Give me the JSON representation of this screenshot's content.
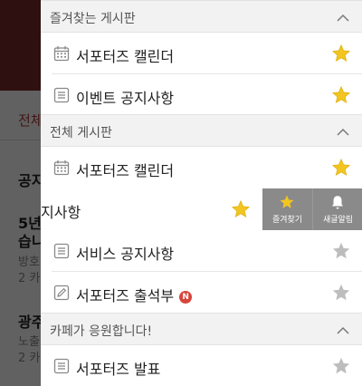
{
  "background": {
    "tab": "전체",
    "items": [
      "공지",
      "5년",
      "습니",
      "방호",
      "2 카",
      "광주",
      "노출",
      "2 카"
    ]
  },
  "sections": [
    {
      "title": "즐겨찾는 게시판",
      "rows": [
        {
          "label": "서포터즈 캘린더",
          "icon": "calendar-icon",
          "starred": true
        },
        {
          "label": "이벤트 공지사항",
          "icon": "list-icon",
          "starred": true
        }
      ]
    },
    {
      "title": "전체 게시판",
      "rows": [
        {
          "label": "서포터즈 캘린더",
          "icon": "calendar-icon",
          "starred": true
        },
        {
          "label": "지사항",
          "icon": "list-icon",
          "starred": true
        },
        {
          "label": "서비스 공지사항",
          "icon": "list-icon",
          "starred": false
        },
        {
          "label": "서포터즈 출석부",
          "icon": "pencil-icon",
          "starred": false,
          "badge": "N"
        }
      ]
    },
    {
      "title": "카페가 응원합니다!",
      "rows": [
        {
          "label": "서포터즈 발표",
          "icon": "list-icon",
          "starred": false
        }
      ]
    }
  ],
  "swipe_actions": {
    "favorite": "즐겨찾기",
    "notify": "새글알림"
  },
  "colors": {
    "star_on": "#f2c521",
    "star_off": "#bdbdbd",
    "action_bg": "#8a8a8a",
    "badge": "#d8453a"
  }
}
